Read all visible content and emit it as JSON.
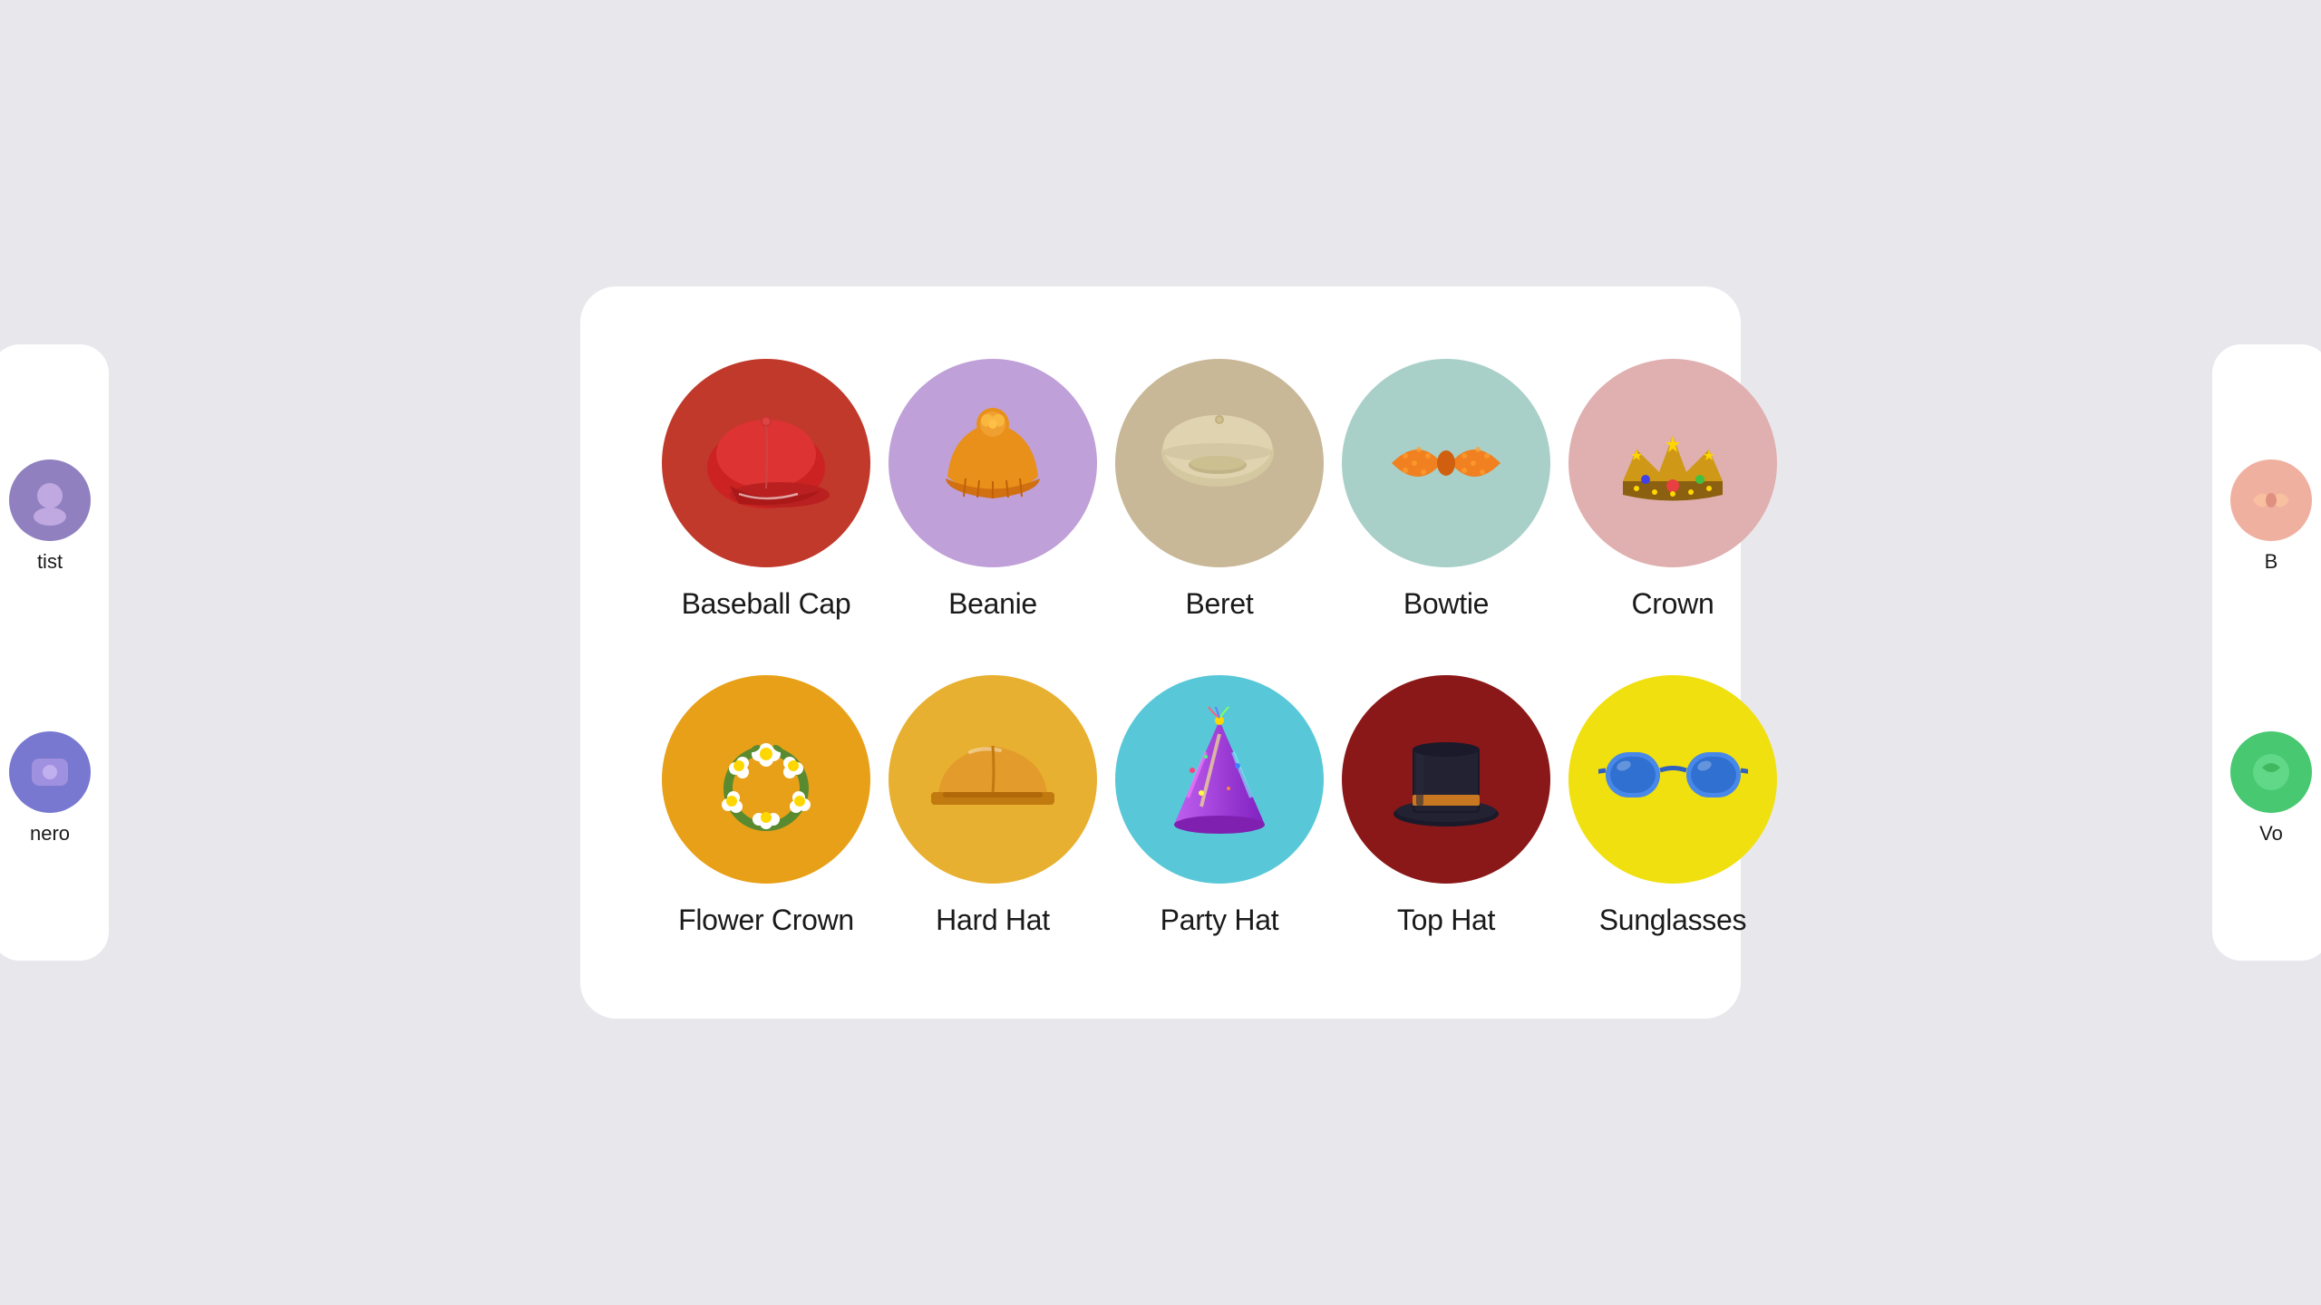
{
  "page": {
    "background_color": "#e8e8ec"
  },
  "left_card": {
    "items": [
      {
        "label": "tist",
        "bg": "#7b6bb8",
        "emoji": "🎨",
        "circle_bg": "#a090d0"
      },
      {
        "label": "nero",
        "bg": "#6060c0",
        "emoji": "🎭",
        "circle_bg": "#7878d8"
      }
    ]
  },
  "right_card": {
    "items": [
      {
        "label": "B",
        "bg": "#f5c0b0",
        "emoji": "🎀",
        "circle_bg": "#f0b8a0"
      },
      {
        "label": "Vo",
        "bg": "#40b870",
        "emoji": "🎵",
        "circle_bg": "#50c880"
      }
    ]
  },
  "main_card": {
    "items": [
      {
        "id": "baseball-cap",
        "label": "Baseball Cap",
        "bg_color": "#c0392b",
        "emoji": "🧢",
        "color_class": "bg-red-dark"
      },
      {
        "id": "beanie",
        "label": "Beanie",
        "bg_color": "#b090cc",
        "emoji": "🧶",
        "color_class": "bg-purple-light"
      },
      {
        "id": "beret",
        "label": "Beret",
        "bg_color": "#c8b89a",
        "emoji": "🪖",
        "color_class": "bg-warm-gray"
      },
      {
        "id": "bowtie",
        "label": "Bowtie",
        "bg_color": "#b8d8d0",
        "emoji": "🎀",
        "color_class": "bg-teal-light"
      },
      {
        "id": "crown",
        "label": "Crown",
        "bg_color": "#e8b8b8",
        "emoji": "👑",
        "color_class": "bg-pink-light"
      },
      {
        "id": "flower-crown",
        "label": "Flower Crown",
        "bg_color": "#e8a020",
        "emoji": "🌸",
        "color_class": "bg-yellow-orange"
      },
      {
        "id": "hard-hat",
        "label": "Hard Hat",
        "bg_color": "#e8b030",
        "emoji": "⛑️",
        "color_class": "bg-yellow-bright"
      },
      {
        "id": "party-hat",
        "label": "Party Hat",
        "bg_color": "#60c8d8",
        "emoji": "🎉",
        "color_class": "bg-cyan-light"
      },
      {
        "id": "top-hat",
        "label": "Top Hat",
        "bg_color": "#8b1a1a",
        "emoji": "🎩",
        "color_class": "bg-crimson"
      },
      {
        "id": "sunglasses",
        "label": "Sunglasses",
        "bg_color": "#f0e010",
        "emoji": "😎",
        "color_class": "bg-yellow-vivid"
      }
    ]
  }
}
